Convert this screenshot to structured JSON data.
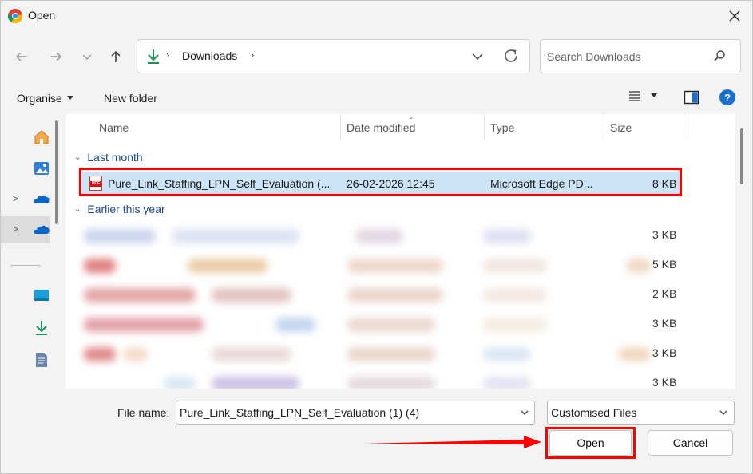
{
  "window": {
    "title": "Open"
  },
  "address": {
    "location": "Downloads",
    "sep": "›"
  },
  "search": {
    "placeholder": "Search Downloads"
  },
  "commands": {
    "organise": "Organise",
    "new_folder": "New folder"
  },
  "columns": {
    "name": "Name",
    "date": "Date modified",
    "type": "Type",
    "size": "Size"
  },
  "groups": {
    "last_month": "Last month",
    "earlier_this_year": "Earlier this year"
  },
  "selected_file": {
    "name": "Pure_Link_Staffing_LPN_Self_Evaluation (...",
    "date": "26-02-2026 12:45",
    "type": "Microsoft Edge PD...",
    "size": "8 KB",
    "icon_label": "PDF"
  },
  "blurred_sizes": [
    "3 KB",
    "5 KB",
    "2 KB",
    "3 KB",
    "3 KB",
    "3 KB"
  ],
  "footer": {
    "file_name_label": "File name:",
    "file_name_value": "Pure_Link_Staffing_LPN_Self_Evaluation (1) (4)",
    "file_type_value": "Customised Files",
    "open_label": "Open",
    "cancel_label": "Cancel"
  },
  "colors": {
    "accent": "#1a6fd1",
    "highlight": "#ff0000",
    "selection": "#cce4f7",
    "download_green": "#1a8f5a"
  },
  "icons": {
    "title_app": "chrome-icon",
    "nav": [
      "back-arrow-icon",
      "forward-arrow-icon",
      "recent-chevron-icon",
      "up-arrow-icon"
    ],
    "sidebar": [
      "home-icon",
      "gallery-icon",
      "onedrive-icon",
      "onedrive-icon",
      "desktop-icon",
      "downloads-icon",
      "documents-icon"
    ]
  }
}
